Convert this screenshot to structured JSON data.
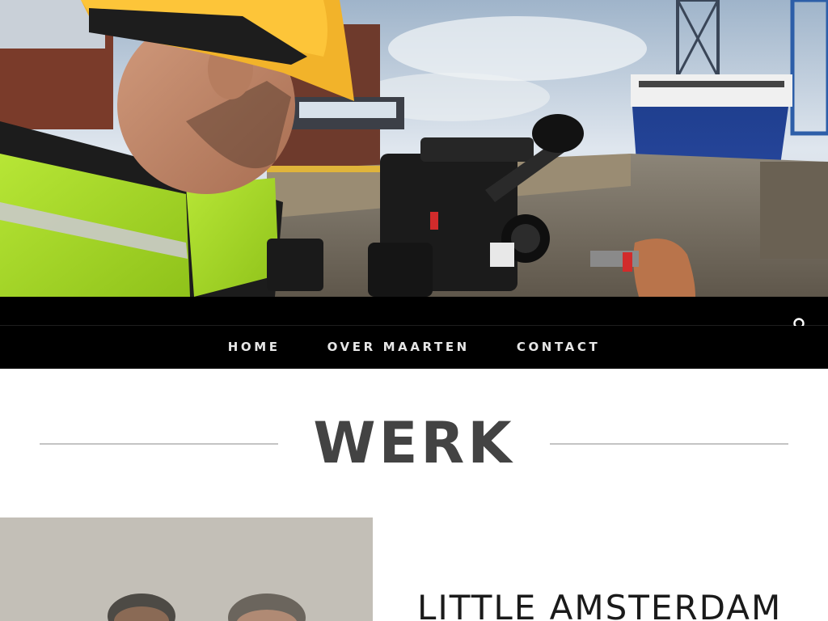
{
  "nav": {
    "items": [
      {
        "label": "HOME"
      },
      {
        "label": "OVER MAARTEN"
      },
      {
        "label": "CONTACT"
      }
    ]
  },
  "icons": {
    "search": "search-icon"
  },
  "section": {
    "title": "WERK"
  },
  "work": {
    "items": [
      {
        "title": "LITTLE AMSTERDAM"
      }
    ]
  },
  "colors": {
    "nav_background": "#000000",
    "nav_text": "#e6e6e6",
    "title_text": "#434343",
    "title_rule": "#c4c4c4"
  }
}
